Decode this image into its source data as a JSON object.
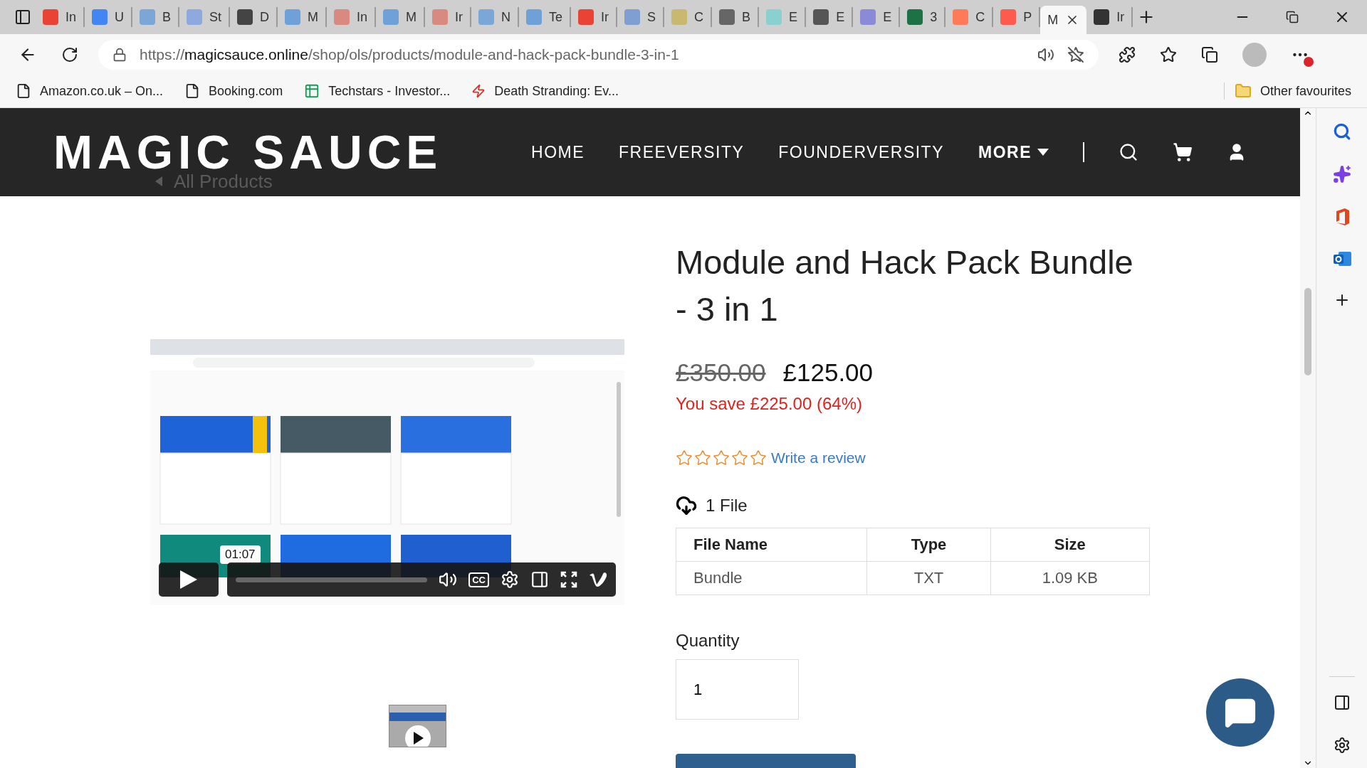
{
  "tabs": [
    {
      "title": "In",
      "color": "#ea4335",
      "selected": false
    },
    {
      "title": "U",
      "color": "#4285f4",
      "selected": false
    },
    {
      "title": "B",
      "color": "#7aa7d8",
      "selected": false
    },
    {
      "title": "St",
      "color": "#8fa8e0",
      "selected": false
    },
    {
      "title": "D",
      "color": "#444444",
      "selected": false
    },
    {
      "title": "M",
      "color": "#6fa0d8",
      "selected": false
    },
    {
      "title": "In",
      "color": "#d98a80",
      "selected": false
    },
    {
      "title": "M",
      "color": "#6fa0d8",
      "selected": false
    },
    {
      "title": "Ir",
      "color": "#d98a80",
      "selected": false
    },
    {
      "title": "N",
      "color": "#7aa7d8",
      "selected": false
    },
    {
      "title": "Te",
      "color": "#6fa0d8",
      "selected": false
    },
    {
      "title": "Ir",
      "color": "#ea4335",
      "selected": false
    },
    {
      "title": "S",
      "color": "#7f9fd0",
      "selected": false
    },
    {
      "title": "C",
      "color": "#c8b870",
      "selected": false
    },
    {
      "title": "B",
      "color": "#666666",
      "selected": false
    },
    {
      "title": "E",
      "color": "#8ad0d0",
      "selected": false
    },
    {
      "title": "E",
      "color": "#555555",
      "selected": false
    },
    {
      "title": "E",
      "color": "#8a8ad8",
      "selected": false
    },
    {
      "title": "3",
      "color": "#1e7145",
      "selected": false
    },
    {
      "title": "C",
      "color": "#ff7a59",
      "selected": false
    },
    {
      "title": "P",
      "color": "#ff5a4e",
      "selected": false
    },
    {
      "title": "M",
      "selected": true
    },
    {
      "title": "Ir",
      "color": "#333333",
      "selected": false
    }
  ],
  "address": {
    "scheme": "https://",
    "host": "magicsauce.online",
    "path": "/shop/ols/products/module-and-hack-pack-bundle-3-in-1"
  },
  "bookmarks": [
    {
      "label": "Amazon.co.uk – On...",
      "kind": "page"
    },
    {
      "label": "Booking.com",
      "kind": "page"
    },
    {
      "label": "Techstars - Investor...",
      "kind": "sheet"
    },
    {
      "label": "Death Stranding: Ev...",
      "kind": "bolt"
    }
  ],
  "other_favourites": "Other favourites",
  "site": {
    "logo": "MAGIC SAUCE",
    "breadcrumb": "All Products",
    "nav": [
      {
        "label": "HOME",
        "kind": "link"
      },
      {
        "label": "FREEVERSITY",
        "kind": "link"
      },
      {
        "label": "FOUNDERVERSITY",
        "kind": "link"
      },
      {
        "label": "MORE",
        "kind": "menu"
      }
    ]
  },
  "video": {
    "time": "01:07",
    "captions": "CC"
  },
  "product": {
    "title": "Module and Hack Pack Bundle - 3 in 1",
    "old_price": "£350.00",
    "price": "£125.00",
    "savings": "You save £225.00 (64%)"
  },
  "review": {
    "stars": 0,
    "link": "Write a review"
  },
  "files": {
    "label": "1 File",
    "columns": [
      "File Name",
      "Type",
      "Size"
    ],
    "rows": [
      [
        "Bundle",
        "TXT",
        "1.09 KB"
      ]
    ]
  },
  "quantity": {
    "label": "Quantity",
    "value": "1"
  }
}
